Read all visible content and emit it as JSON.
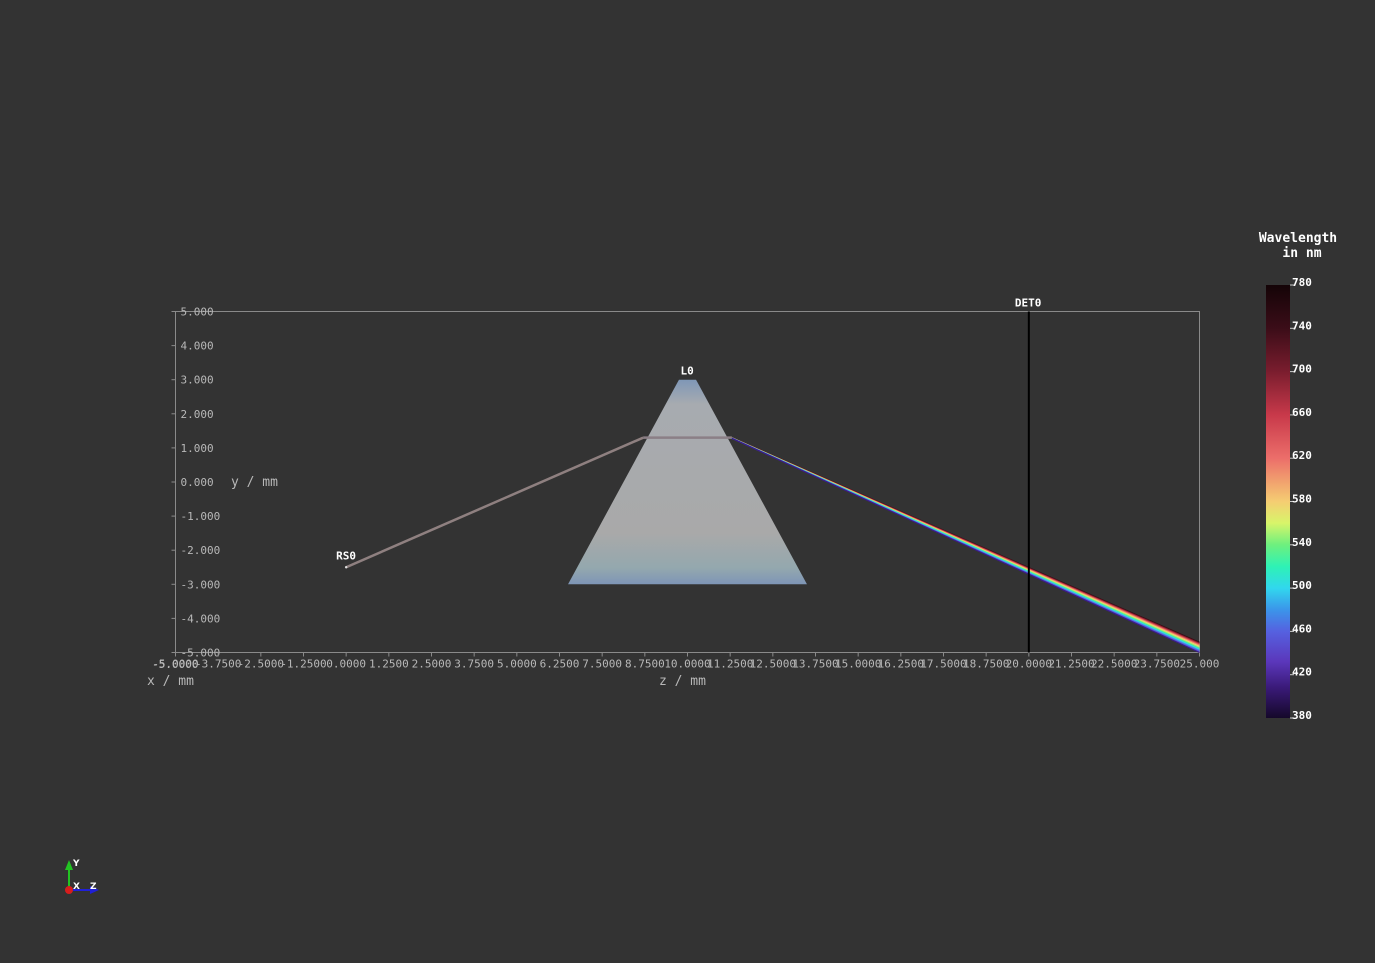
{
  "objects": {
    "source_label": "RS0",
    "lens_label": "L0",
    "detector_label": "DET0"
  },
  "axes": {
    "y_label": "y / mm",
    "z_label": "z / mm",
    "x_label": "x / mm",
    "x_overlap_tick": "-5.0000",
    "y_ticks": [
      "5.000",
      "4.000",
      "3.000",
      "2.000",
      "1.000",
      "0.000",
      "-1.000",
      "-2.000",
      "-3.000",
      "-4.000",
      "-5.000"
    ],
    "z_ticks": [
      "-5.0000",
      "-3.7500",
      "-2.5000",
      "-1.2500",
      "0.0000",
      "1.2500",
      "2.5000",
      "3.7500",
      "5.0000",
      "6.2500",
      "7.5000",
      "8.7500",
      "10.0000",
      "11.2500",
      "12.5000",
      "13.7500",
      "15.0000",
      "16.2500",
      "17.5000",
      "18.7500",
      "20.0000",
      "21.2500",
      "22.5000",
      "23.7500",
      "25.000"
    ],
    "z_range": [
      -5,
      25
    ],
    "y_range": [
      -5,
      5
    ]
  },
  "scene": {
    "source_position_mm": [
      0.0,
      -2.5
    ],
    "lens_apex_mm": [
      10.0,
      3.0
    ],
    "lens_base_mm": [
      [
        6.5,
        -3.0
      ],
      [
        13.5,
        -3.0
      ]
    ],
    "ray_hit_mm": [
      [
        8.7,
        1.3
      ],
      [
        11.3,
        1.3
      ]
    ],
    "detector_z_mm": 20.0,
    "spectrum_end_y_mm": {
      "red": -4.7,
      "violet": -5.0
    }
  },
  "colorbar": {
    "title_line1": "Wavelength",
    "title_line2": "in nm",
    "ticks": [
      "780",
      "740",
      "700",
      "660",
      "620",
      "580",
      "540",
      "500",
      "460",
      "420",
      "380"
    ],
    "range": [
      380,
      780
    ]
  },
  "orientation": {
    "y": "Y",
    "x": "X",
    "z": "Z"
  },
  "colors": {
    "background": "#333333",
    "frame": "#8a8a8a",
    "lens_fill": "#a9a9a9",
    "ray": "#8f8080",
    "detector": "#000000"
  }
}
